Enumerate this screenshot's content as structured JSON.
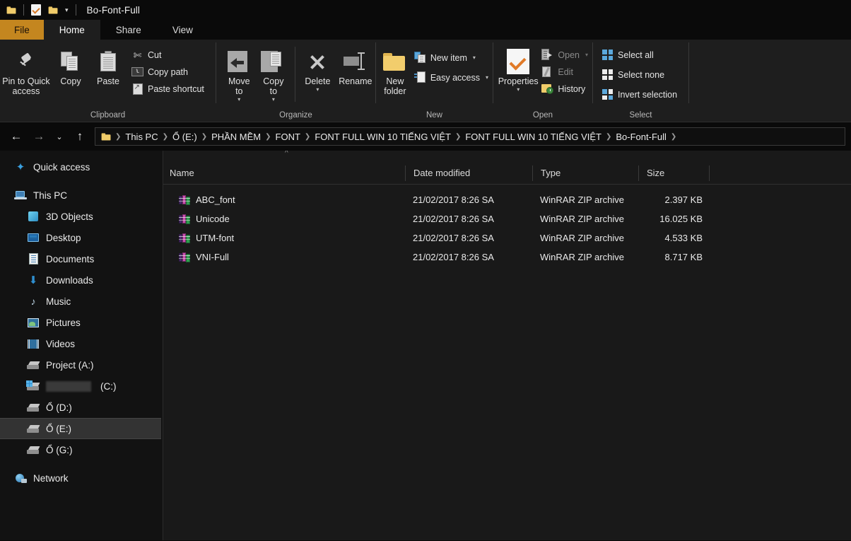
{
  "window": {
    "title": "Bo-Font-Full",
    "quick_access_icons": [
      "folder-icon",
      "properties-icon",
      "new-folder-icon",
      "customize-chevron-icon"
    ]
  },
  "tabs": [
    {
      "label": "File",
      "state": "file"
    },
    {
      "label": "Home",
      "state": "active"
    },
    {
      "label": "Share",
      "state": "normal"
    },
    {
      "label": "View",
      "state": "normal"
    }
  ],
  "ribbon": {
    "groups": [
      {
        "label": "Clipboard",
        "big_buttons": [
          {
            "label_line1": "Pin to Quick",
            "label_line2": "access",
            "icon": "pin-icon"
          },
          {
            "label_line1": "Copy",
            "label_line2": "",
            "icon": "copy-pages-icon"
          },
          {
            "label_line1": "Paste",
            "label_line2": "",
            "icon": "clipboard-icon"
          }
        ],
        "small_buttons": [
          {
            "label": "Cut",
            "icon": "scissors-icon",
            "disabled": false,
            "caret": false
          },
          {
            "label": "Copy path",
            "icon": "copy-path-icon",
            "disabled": false,
            "caret": false
          },
          {
            "label": "Paste shortcut",
            "icon": "paste-shortcut-icon",
            "disabled": false,
            "caret": false
          }
        ]
      },
      {
        "label": "Organize",
        "big_buttons": [
          {
            "label_line1": "Move",
            "label_line2": "to",
            "icon": "move-to-icon",
            "caret": true
          },
          {
            "label_line1": "Copy",
            "label_line2": "to",
            "icon": "copy-to-icon",
            "caret": true
          },
          {
            "label_line1": "Delete",
            "label_line2": "",
            "icon": "delete-x-icon",
            "caret": true
          },
          {
            "label_line1": "Rename",
            "label_line2": "",
            "icon": "rename-icon",
            "caret": false
          }
        ]
      },
      {
        "label": "New",
        "big_buttons": [
          {
            "label_line1": "New",
            "label_line2": "folder",
            "icon": "new-folder-icon"
          }
        ],
        "small_buttons": [
          {
            "label": "New item",
            "icon": "new-item-icon",
            "caret": true
          },
          {
            "label": "Easy access",
            "icon": "easy-access-icon",
            "caret": true
          }
        ]
      },
      {
        "label": "Open",
        "big_buttons": [
          {
            "label_line1": "Properties",
            "label_line2": "",
            "icon": "properties-icon",
            "caret": true
          }
        ],
        "small_buttons": [
          {
            "label": "Open",
            "icon": "open-icon",
            "disabled": true,
            "caret": true
          },
          {
            "label": "Edit",
            "icon": "edit-icon",
            "disabled": true,
            "caret": false
          },
          {
            "label": "History",
            "icon": "history-icon",
            "disabled": false,
            "caret": false
          }
        ]
      },
      {
        "label": "Select",
        "small_buttons": [
          {
            "label": "Select all",
            "icon": "select-all-icon",
            "caret": false
          },
          {
            "label": "Select none",
            "icon": "select-none-icon",
            "caret": false
          },
          {
            "label": "Invert selection",
            "icon": "invert-selection-icon",
            "caret": false
          }
        ]
      }
    ]
  },
  "addressbar": {
    "back_label": "←",
    "forward_label": "→",
    "recent_label": "⌄",
    "up_label": "↑",
    "breadcrumbs": [
      "This PC",
      "Ổ (E:)",
      "PHẦN MỀM",
      "FONT",
      "FONT FULL WIN 10 TIẾNG VIỆT",
      "FONT FULL WIN 10 TIẾNG VIỆT",
      "Bo-Font-Full"
    ]
  },
  "sidebar": {
    "items": [
      {
        "label": "Quick access",
        "icon": "star-icon",
        "level": "root",
        "selected": false,
        "gap_after": true
      },
      {
        "label": "This PC",
        "icon": "this-pc-icon",
        "level": "root",
        "selected": false
      },
      {
        "label": "3D Objects",
        "icon": "3d-objects-icon",
        "level": "child",
        "selected": false
      },
      {
        "label": "Desktop",
        "icon": "desktop-icon",
        "level": "child",
        "selected": false
      },
      {
        "label": "Documents",
        "icon": "documents-icon",
        "level": "child",
        "selected": false
      },
      {
        "label": "Downloads",
        "icon": "downloads-icon",
        "level": "child",
        "selected": false
      },
      {
        "label": "Music",
        "icon": "music-icon",
        "level": "child",
        "selected": false
      },
      {
        "label": "Pictures",
        "icon": "pictures-icon",
        "level": "child",
        "selected": false
      },
      {
        "label": "Videos",
        "icon": "videos-icon",
        "level": "child",
        "selected": false
      },
      {
        "label": "Project (A:)",
        "icon": "drive-icon",
        "level": "child",
        "selected": false
      },
      {
        "label": "(C:)",
        "icon": "os-drive-icon",
        "level": "child",
        "selected": false,
        "redacted": true
      },
      {
        "label": "Ổ (D:)",
        "icon": "drive-icon",
        "level": "child",
        "selected": false
      },
      {
        "label": "Ổ (E:)",
        "icon": "drive-icon",
        "level": "child",
        "selected": true
      },
      {
        "label": "Ổ (G:)",
        "icon": "drive-icon",
        "level": "child",
        "selected": false,
        "gap_after": true
      },
      {
        "label": "Network",
        "icon": "network-icon",
        "level": "root",
        "selected": false
      }
    ]
  },
  "filelist": {
    "sort_indicator": "^",
    "columns": [
      "Name",
      "Date modified",
      "Type",
      "Size"
    ],
    "rows": [
      {
        "name": "ABC_font",
        "date": "21/02/2017 8:26 SA",
        "type": "WinRAR ZIP archive",
        "size": "2.397 KB",
        "icon": "winrar-archive-icon"
      },
      {
        "name": "Unicode",
        "date": "21/02/2017 8:26 SA",
        "type": "WinRAR ZIP archive",
        "size": "16.025 KB",
        "icon": "winrar-archive-icon"
      },
      {
        "name": "UTM-font",
        "date": "21/02/2017 8:26 SA",
        "type": "WinRAR ZIP archive",
        "size": "4.533 KB",
        "icon": "winrar-archive-icon"
      },
      {
        "name": "VNI-Full",
        "date": "21/02/2017 8:26 SA",
        "type": "WinRAR ZIP archive",
        "size": "8.717 KB",
        "icon": "winrar-archive-icon"
      }
    ]
  },
  "colors": {
    "file_tab": "#c4861f",
    "window_bg": "#0a0a0a",
    "ribbon_bg": "#1e1e1e",
    "content_bg": "#191919",
    "sidebar_bg": "#121212",
    "selection": "#333333"
  }
}
